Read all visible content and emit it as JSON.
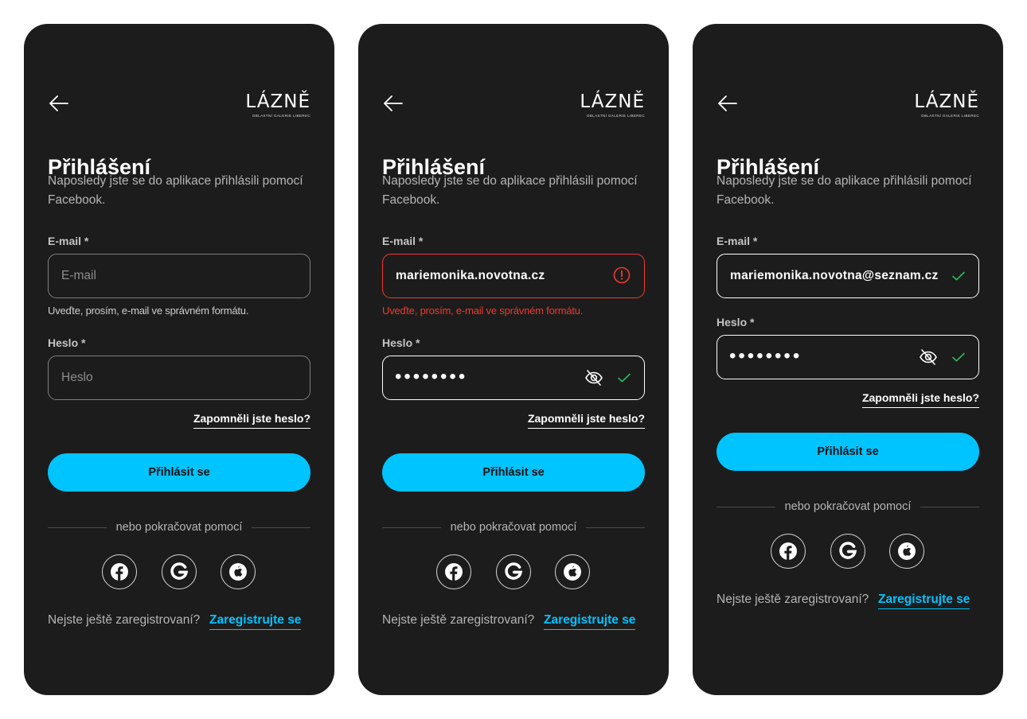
{
  "brand": {
    "logo": "LÁZNĚ",
    "logo_sub": "OBLASTNÍ GALERIE LIBEREC",
    "accent": "#00c4ff",
    "error": "#ef3b2f",
    "success": "#27c05a",
    "background": "#1c1c1d"
  },
  "icons": {
    "back": "arrow-left-icon",
    "error": "exclamation-circle-icon",
    "valid": "checkmark-icon",
    "visibility": "eye-off-icon",
    "social": [
      "facebook-icon",
      "google-icon",
      "apple-icon"
    ]
  },
  "screens": [
    {
      "title": "Přihlášení",
      "subtitle": "Naposledy jste se do aplikace přihlásili pomocí Facebook.",
      "email_label": "E-mail  *",
      "email_placeholder": "E-mail",
      "email_value": "",
      "email_hint": "Uveďte, prosím, e-mail ve správném formátu.",
      "password_label": "Heslo  *",
      "password_placeholder": "Heslo",
      "password_value": "",
      "forgot": "Zapomněli jste heslo?",
      "submit": "Přihlásit se",
      "divider": "nebo pokračovat pomocí",
      "register_text": "Nejste ještě zaregistrovaní?",
      "register_link": "Zaregistrujte se"
    },
    {
      "title": "Přihlášení",
      "subtitle": "Naposledy jste se do aplikace přihlásili pomocí Facebook.",
      "email_label": "E-mail  *",
      "email_value": "mariemonika.novotna.cz",
      "email_error": "Uveďte, prosím, e-mail ve správném formátu.",
      "password_label": "Heslo  *",
      "password_value": "••••••••",
      "forgot": "Zapomněli jste heslo?",
      "submit": "Přihlásit se",
      "divider": "nebo pokračovat pomocí",
      "register_text": "Nejste ještě zaregistrovaní?",
      "register_link": "Zaregistrujte se"
    },
    {
      "title": "Přihlášení",
      "subtitle": "Naposledy jste se do aplikace přihlásili pomocí Facebook.",
      "email_label": "E-mail  *",
      "email_value": "mariemonika.novotna@seznam.cz",
      "password_label": "Heslo  *",
      "password_value": "••••••••",
      "forgot": "Zapomněli jste heslo?",
      "submit": "Přihlásit se",
      "divider": "nebo pokračovat pomocí",
      "register_text": "Nejste ještě zaregistrovaní?",
      "register_link": "Zaregistrujte se"
    }
  ]
}
